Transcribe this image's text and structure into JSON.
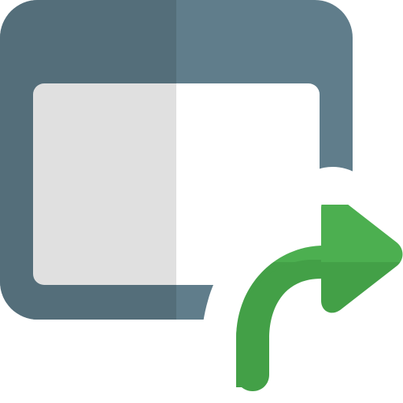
{
  "icon": {
    "name": "window-share-icon",
    "parts": [
      "browser-window-icon",
      "forward-arrow-icon"
    ],
    "colors": {
      "window_frame_light": "#607D8B",
      "window_frame_dark": "#546E7A",
      "window_content_light": "#FFFFFF",
      "window_content_dark": "#E0E0E0",
      "arrow_light": "#4CAF50",
      "arrow_dark": "#43A047",
      "cutout": "#FFFFFF"
    }
  }
}
